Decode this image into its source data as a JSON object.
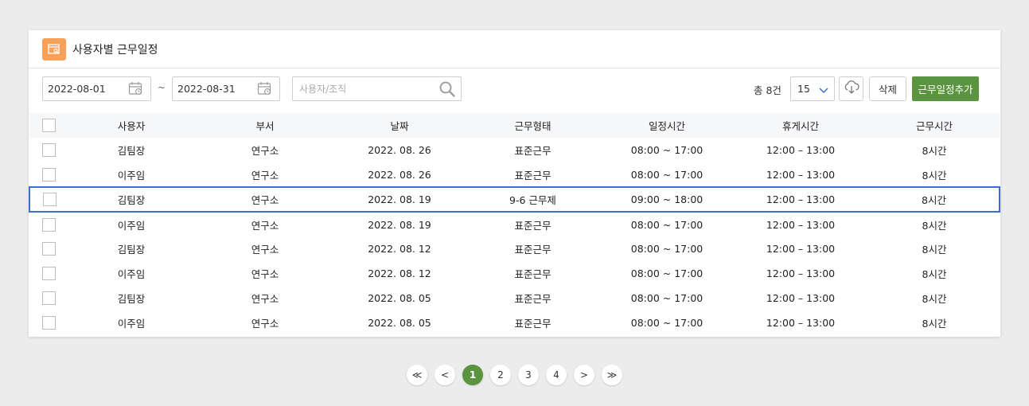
{
  "header": {
    "title": "사용자별 근무일정",
    "icon": "calendar-search-icon"
  },
  "filters": {
    "start_date": "2022-08-01",
    "end_date": "2022-08-31",
    "separator": "~",
    "search_placeholder": "사용자/조직",
    "search_value": ""
  },
  "toolbar": {
    "total": "총 8건",
    "page_size": "15",
    "delete_label": "삭제",
    "add_label": "근무일정추가",
    "accent": "#5a9440"
  },
  "table": {
    "headers": [
      "사용자",
      "부서",
      "날짜",
      "근무형태",
      "일정시간",
      "휴게시간",
      "근무시간"
    ],
    "rows": [
      [
        "김팀장",
        "연구소",
        "2022. 08. 26",
        "표준근무",
        "08:00 ~ 17:00",
        "12:00 – 13:00",
        "8시간"
      ],
      [
        "이주임",
        "연구소",
        "2022. 08. 26",
        "표준근무",
        "08:00 ~ 17:00",
        "12:00 – 13:00",
        "8시간"
      ],
      [
        "김팀장",
        "연구소",
        "2022. 08. 19",
        "9-6 근무제",
        "09:00 ~ 18:00",
        "12:00 – 13:00",
        "8시간"
      ],
      [
        "이주임",
        "연구소",
        "2022. 08. 19",
        "표준근무",
        "08:00 ~ 17:00",
        "12:00 – 13:00",
        "8시간"
      ],
      [
        "김팀장",
        "연구소",
        "2022. 08. 12",
        "표준근무",
        "08:00 ~ 17:00",
        "12:00 – 13:00",
        "8시간"
      ],
      [
        "이주임",
        "연구소",
        "2022. 08. 12",
        "표준근무",
        "08:00 ~ 17:00",
        "12:00 – 13:00",
        "8시간"
      ],
      [
        "김팀장",
        "연구소",
        "2022. 08. 05",
        "표준근무",
        "08:00 ~ 17:00",
        "12:00 – 13:00",
        "8시간"
      ],
      [
        "이주임",
        "연구소",
        "2022. 08. 05",
        "표준근무",
        "08:00 ~ 17:00",
        "12:00 – 13:00",
        "8시간"
      ]
    ],
    "selected_row": 2
  },
  "pagination": {
    "first": "≪",
    "prev": "<",
    "next": ">",
    "last": "≫",
    "pages": [
      "1",
      "2",
      "3",
      "4"
    ],
    "current": "1"
  }
}
